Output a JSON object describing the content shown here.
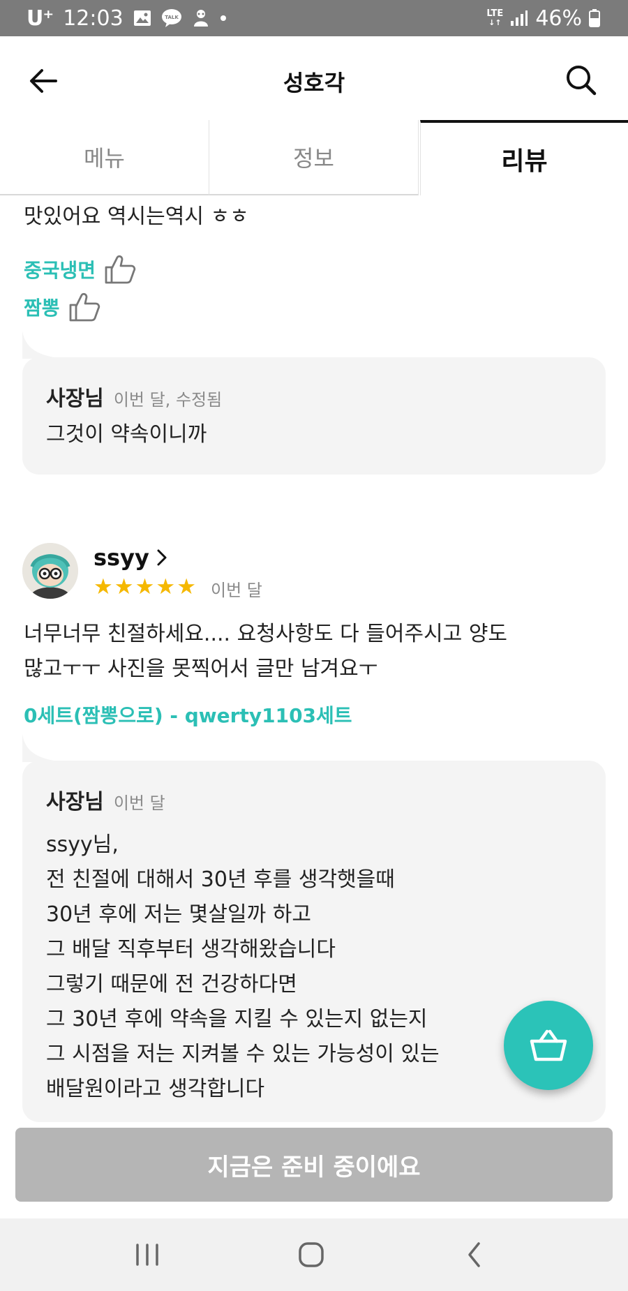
{
  "status_bar": {
    "carrier": "U⁺",
    "time": "12:03",
    "network": "LTE",
    "battery": "46%"
  },
  "header": {
    "title": "성호각"
  },
  "tabs": [
    {
      "label": "메뉴",
      "active": false
    },
    {
      "label": "정보",
      "active": false
    },
    {
      "label": "리뷰",
      "active": true
    }
  ],
  "reviews": [
    {
      "text": "맛있어요 역시는역시 ㅎㅎ",
      "menu_tags": [
        "중국냉면",
        "짬뽕"
      ],
      "reply": {
        "author": "사장님",
        "date": "이번 달, 수정됨",
        "lines": [
          "그것이 약속이니까"
        ]
      }
    },
    {
      "username": "ssyy",
      "rating": 5,
      "date": "이번 달",
      "text_lines": [
        "너무너무 친절하세요.... 요청사항도 다 들어주시고 양도",
        "많고ㅜㅜ 사진을 못찍어서 글만 남겨요ㅜ"
      ],
      "menu": "0세트(짬뽕으로) - qwerty1103세트",
      "reply": {
        "author": "사장님",
        "date": "이번 달",
        "lines": [
          "ssyy님,",
          "전 친절에 대해서 30년 후를 생각햇을때",
          "30년 후에 저는 몇살일까 하고",
          "그 배달 직후부터 생각해왔습니다",
          "그렇기 때문에 전 건강하다면",
          "그 30년 후에 약속을 지킬 수 있는지 없는지",
          "그 시점을 저는 지켜볼 수 있는 가능성이 있는",
          "배달원이라고 생각합니다"
        ]
      }
    }
  ],
  "cart": {
    "icon": "basket-icon"
  },
  "cta": {
    "label": "지금은 준비 중이에요"
  },
  "colors": {
    "accent": "#2bc3b8",
    "star": "#f5b800",
    "cta_disabled": "#b5b5b5"
  }
}
